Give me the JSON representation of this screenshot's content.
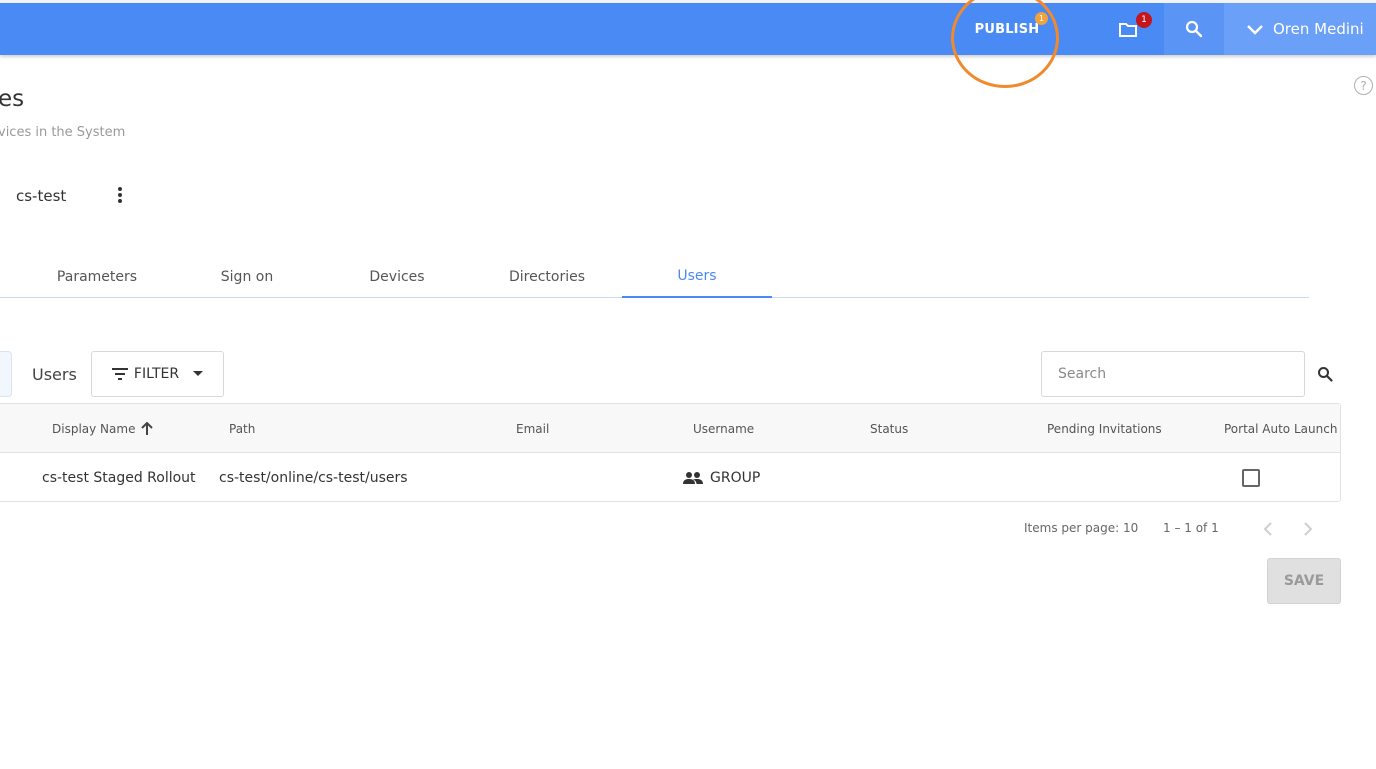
{
  "topbar": {
    "publish_label": "PUBLISH",
    "publish_badge": "1",
    "folder_badge": "1",
    "user_name": "Oren Medini",
    "bar_color": "#4a8af4",
    "highlight_color": "#f08a2c"
  },
  "page": {
    "title": "es",
    "subtitle": "vices in the System",
    "entity_name": "cs-test",
    "help_glyph": "?"
  },
  "tabs": [
    {
      "label": "Parameters",
      "active": false
    },
    {
      "label": "Sign on",
      "active": false
    },
    {
      "label": "Devices",
      "active": false
    },
    {
      "label": "Directories",
      "active": false
    },
    {
      "label": "Users",
      "active": true
    }
  ],
  "toolbar": {
    "section_label": "Users",
    "filter_label": "FILTER",
    "search_placeholder": "Search"
  },
  "table": {
    "columns": [
      "Display Name",
      "Path",
      "Email",
      "Username",
      "Status",
      "Pending Invitations",
      "Portal Auto Launch"
    ],
    "sorted_column": "Display Name",
    "sort_direction": "ascending",
    "rows": [
      {
        "display_name": "cs-test Staged Rollout",
        "path": "cs-test/online/cs-test/users",
        "email": "",
        "username_icon": "group-icon",
        "username": "GROUP",
        "status": "",
        "pending_invitations": "",
        "portal_auto_launch": false
      }
    ]
  },
  "pagination": {
    "items_per_page": "Items per page: 10",
    "range": "1 – 1 of 1"
  },
  "actions": {
    "save_label": "SAVE"
  }
}
